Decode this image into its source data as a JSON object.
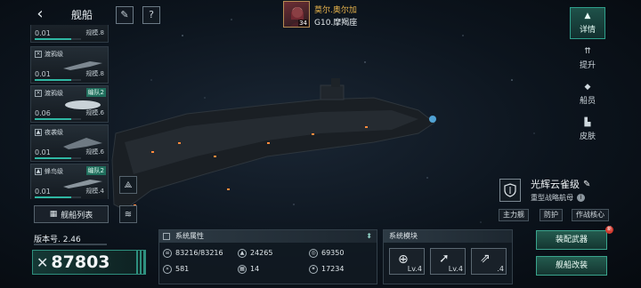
{
  "header": {
    "title": "舰船",
    "back_icon": "back-arrow-icon"
  },
  "ship_list": [
    {
      "class_name": "",
      "value": "0.01",
      "scale": "规模.8",
      "fleet": ""
    },
    {
      "class_name": "渡鸦级",
      "value": "0.01",
      "scale": "规模.8",
      "fleet": ""
    },
    {
      "class_name": "渡鸦级",
      "value": "0.06",
      "scale": "规模.6",
      "fleet": "编队2"
    },
    {
      "class_name": "夜袭级",
      "value": "0.01",
      "scale": "规模.6",
      "fleet": ""
    },
    {
      "class_name": "蜂鸟级",
      "value": "0.01",
      "scale": "规模.4",
      "fleet": "编队2"
    }
  ],
  "fleet_list_label": "舰船列表",
  "version": "版本号. 2.46",
  "power": "87803",
  "commander": {
    "name": "莫尔.奥尔加",
    "rank": "G10.摩羯座",
    "level": "34"
  },
  "right_tabs": [
    {
      "label": "详情",
      "icon": "details-icon",
      "active": true
    },
    {
      "label": "提升",
      "icon": "upgrade-icon",
      "active": false
    },
    {
      "label": "船员",
      "icon": "crew-icon",
      "active": false
    },
    {
      "label": "皮肤",
      "icon": "skin-icon",
      "active": false
    }
  ],
  "ship": {
    "name": "光辉云雀级",
    "type": "重型战略航母",
    "tags": [
      "主力舰",
      "防护",
      "作战核心"
    ]
  },
  "attributes": {
    "title": "系统属性",
    "items": [
      {
        "icon": "hull-icon",
        "value": "83216/83216"
      },
      {
        "icon": "armor-icon",
        "value": "24265"
      },
      {
        "icon": "shield-icon",
        "value": "69350"
      },
      {
        "icon": "speed-icon",
        "value": "581"
      },
      {
        "icon": "evasion-icon",
        "value": "14"
      },
      {
        "icon": "damage-icon",
        "value": "17234"
      }
    ]
  },
  "modules": {
    "title": "系统模块",
    "items": [
      {
        "icon": "target-module-icon",
        "level": "Lv.4"
      },
      {
        "icon": "missile-module-icon",
        "level": "Lv.4"
      },
      {
        "icon": "rocket-module-icon",
        "level": ".4"
      }
    ]
  },
  "actions": {
    "equip": "装配武器",
    "modify": "舰船改装",
    "badge": "新"
  },
  "colors": {
    "accent": "#2fb7a3",
    "gold": "#e7b34b",
    "alert": "#d23b2f"
  }
}
